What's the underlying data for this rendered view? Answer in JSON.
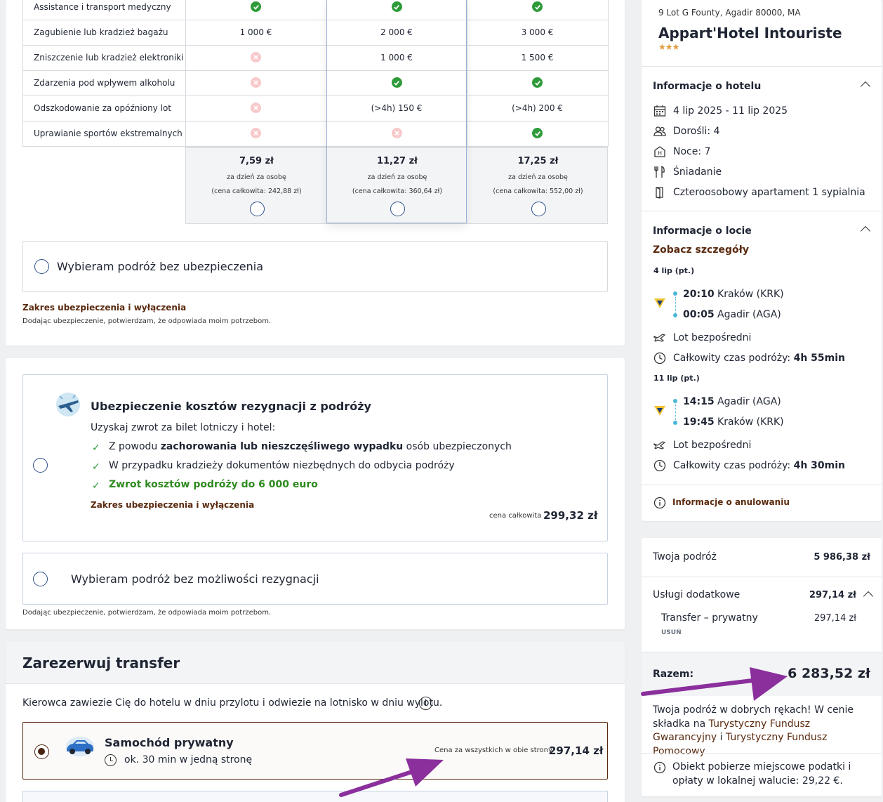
{
  "insurance_table": {
    "rows": [
      {
        "label": "Assistance i transport medyczny",
        "cells": [
          "ok",
          "ok",
          "ok"
        ]
      },
      {
        "label": "Zagubienie lub kradzież bagażu",
        "cells": [
          "1 000 €",
          "2 000 €",
          "3 000 €"
        ]
      },
      {
        "label": "Zniszczenie lub kradzież elektroniki",
        "cells": [
          "no",
          "1 000 €",
          "1 500 €"
        ]
      },
      {
        "label": "Zdarzenia pod wpływem alkoholu",
        "cells": [
          "no",
          "ok",
          "ok"
        ]
      },
      {
        "label": "Odszkodowanie za opóźniony lot",
        "cells": [
          "no",
          "(>4h) 150 €",
          "(>4h) 200 €"
        ]
      },
      {
        "label": "Uprawianie sportów ekstremalnych",
        "cells": [
          "no",
          "no",
          "ok"
        ]
      }
    ],
    "plans": [
      {
        "price": "7,59 zł",
        "per": "za dzień za osobę",
        "total": "(cena całkowita: 242,88 zł)"
      },
      {
        "price": "11,27 zł",
        "per": "za dzień za osobę",
        "total": "(cena całkowita: 360,64 zł)"
      },
      {
        "price": "17,25 zł",
        "per": "za dzień za osobę",
        "total": "(cena całkowita: 552,00 zł)"
      }
    ],
    "no_insurance_label": "Wybieram podróż bez ubezpieczenia",
    "scope_link": "Zakres ubezpieczenia i wyłączenia",
    "confirm_note": "Dodając ubezpieczenie, potwierdzam, że odpowiada moim potrzebom."
  },
  "cancellation": {
    "title": "Ubezpieczenie kosztów rezygnacji z podróży",
    "subtitle": "Uzyskaj zwrot za bilet lotniczy i hotel:",
    "item1_pre": "Z powodu ",
    "item1_bold": "zachorowania lub nieszczęśliwego wypadku",
    "item1_post": " osób ubezpieczonych",
    "item2": "W przypadku kradzieży dokumentów niezbędnych do odbycia podróży",
    "item3": "Zwrot kosztów podróży do 6 000 euro",
    "scope_link": "Zakres ubezpieczenia i wyłączenia",
    "total_label": "cena całkowita",
    "total_price": "299,32 zł",
    "no_cancel_label": "Wybieram podróż bez możliwości rezygnacji",
    "confirm_note": "Dodając ubezpieczenie, potwierdzam, że odpowiada moim potrzebom."
  },
  "transfer": {
    "title": "Zarezerwuj transfer",
    "description": "Kierowca zawiezie Cię do hotelu w dniu przylotu i odwiezie na lotnisko w dniu wylotu.",
    "option_name": "Samochód prywatny",
    "option_duration": "ok. 30 min w jedną stronę",
    "price_label": "Cena za wszystkich w obie strony",
    "price": "297,14 zł"
  },
  "hotel": {
    "address": "9 Lot G Founty, Agadir 80000, MA",
    "name": "Appart'Hotel Intouriste",
    "stars": "★★★",
    "info_title": "Informacje o hotelu",
    "dates": "4 lip 2025 - 11 lip 2025",
    "adults": "Dorośli: 4",
    "nights": "Noce: 7",
    "board": "Śniadanie",
    "room": "Czteroosobowy apartament 1 sypialnia"
  },
  "flights": {
    "title": "Informacje o locie",
    "details_link": "Zobacz szczegóły",
    "outbound": {
      "date": "4 lip (pt.)",
      "dep_time": "20:10",
      "dep_place": "Kraków (KRK)",
      "arr_time": "00:05",
      "arr_place": "Agadir (AGA)",
      "type": "Lot bezpośredni",
      "duration_label": "Całkowity czas podróży:",
      "duration": "4h 55min"
    },
    "inbound": {
      "date": "11 lip (pt.)",
      "dep_time": "14:15",
      "dep_place": "Agadir (AGA)",
      "arr_time": "19:45",
      "arr_place": "Kraków (KRK)",
      "type": "Lot bezpośredni",
      "duration_label": "Całkowity czas podróży:",
      "duration": "4h 30min"
    },
    "cancellation_info": "Informacje o anulowaniu"
  },
  "summary": {
    "trip_label": "Twoja podróż",
    "trip_value": "5 986,38 zł",
    "extras_label": "Usługi dodatkowe",
    "extras_value": "297,14 zł",
    "transfer_label": "Transfer – prywatny",
    "transfer_value": "297,14 zł",
    "remove": "USUŃ",
    "total_label": "Razem:",
    "total_value": "6 283,52 zł",
    "guarantee_pre": "Twoja podróż w dobrych rękach! W cenie składka na ",
    "guarantee_link1": "Turystyczny Fundusz Gwarancyjny",
    "guarantee_mid": " i ",
    "guarantee_link2": "Turystyczny Fundusz Pomocowy",
    "local_tax": "Obiekt pobierze miejscowe podatki i opłaty w lokalnej walucie: 29,22 €."
  },
  "colors": {
    "brand": "#5a2a0f",
    "check": "#2e9b3a",
    "cross": "#f7c9cb",
    "radio": "#2d4f8c",
    "arrow": "#8a2f9c"
  }
}
